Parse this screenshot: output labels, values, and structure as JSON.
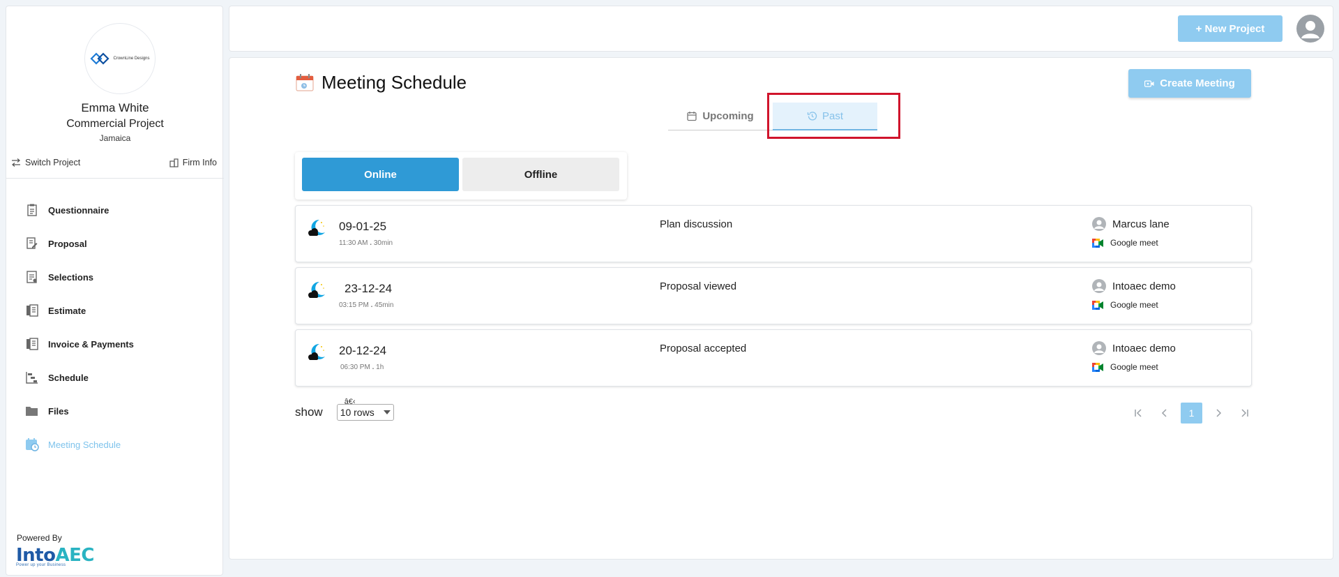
{
  "sidebar": {
    "logo_text": "CrownLine Designs",
    "user_name": "Emma White",
    "project_name": "Commercial Project",
    "location": "Jamaica",
    "switch_project": "Switch Project",
    "firm_info": "Firm Info",
    "items": [
      {
        "label": "Questionnaire",
        "icon": "clipboard-icon"
      },
      {
        "label": "Proposal",
        "icon": "document-edit-icon"
      },
      {
        "label": "Selections",
        "icon": "checklist-icon"
      },
      {
        "label": "Estimate",
        "icon": "receipt-icon"
      },
      {
        "label": "Invoice & Payments",
        "icon": "invoice-icon"
      },
      {
        "label": "Schedule",
        "icon": "gantt-icon"
      },
      {
        "label": "Files",
        "icon": "folder-icon"
      },
      {
        "label": "Meeting Schedule",
        "icon": "calendar-clock-icon",
        "active": true
      }
    ],
    "powered_by": "Powered By",
    "brand_into": "Into",
    "brand_aec": "AEC",
    "brand_tagline": "Power up your Business"
  },
  "topbar": {
    "new_project": "+ New Project"
  },
  "main": {
    "page_title": "Meeting Schedule",
    "create_meeting": "Create Meeting",
    "tabs": [
      {
        "label": "Upcoming",
        "icon": "calendar-icon"
      },
      {
        "label": "Past",
        "icon": "history-icon",
        "active": true
      }
    ],
    "mode": {
      "online": "Online",
      "offline": "Offline",
      "selected": "Online"
    },
    "meetings": [
      {
        "date": "09-01-25",
        "time": "11:30 AM",
        "sep": ".",
        "duration": "30min",
        "title": "Plan discussion",
        "person": "Marcus lane",
        "platform": "Google meet"
      },
      {
        "date": "23-12-24",
        "time": "03:15 PM",
        "sep": ".",
        "duration": "45min",
        "title": "Proposal viewed",
        "person": "Intoaec demo",
        "platform": "Google meet"
      },
      {
        "date": "20-12-24",
        "time": "06:30 PM",
        "sep": ".",
        "duration": "1h",
        "title": "Proposal accepted",
        "person": "Intoaec demo",
        "platform": "Google meet"
      }
    ],
    "show_label": "show",
    "rows_glyph": "â€‹",
    "rows_value": "10 rows",
    "pager": {
      "current": "1",
      "first": "|<",
      "prev": "<",
      "next": ">",
      "last": ">|"
    }
  },
  "colors": {
    "accent": "#2f9ad6",
    "accent_light": "#8fcbf0",
    "highlight": "#d0142c"
  }
}
